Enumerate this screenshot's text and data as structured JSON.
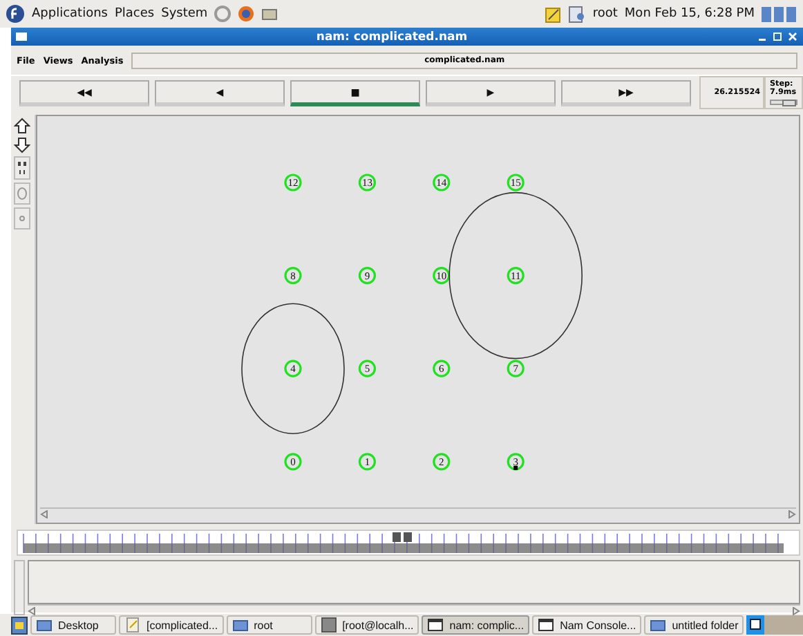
{
  "top_panel": {
    "menus": [
      "Applications",
      "Places",
      "System"
    ],
    "user": "root",
    "clock": "Mon Feb 15,  6:28 PM"
  },
  "window": {
    "title": "nam: complicated.nam"
  },
  "menu_bar": {
    "items": [
      "File",
      "Views",
      "Analysis"
    ],
    "file_name": "complicated.nam"
  },
  "playback": {
    "buttons": [
      {
        "glyph": "◀◀",
        "selected": false
      },
      {
        "glyph": "◀",
        "selected": false
      },
      {
        "glyph": "■",
        "selected": true
      },
      {
        "glyph": "▶",
        "selected": false
      },
      {
        "glyph": "▶▶",
        "selected": false
      }
    ],
    "time": "26.215524",
    "step": "Step: 7.9ms",
    "step_slider": {
      "level": 0.72
    }
  },
  "nodes": [
    {
      "label": "12",
      "kind": "plain",
      "packet": false
    },
    {
      "label": "13",
      "kind": "plain",
      "packet": false
    },
    {
      "label": "14",
      "kind": "plain",
      "packet": false
    },
    {
      "label": "15",
      "kind": "plain",
      "packet": false
    },
    {
      "label": "8",
      "kind": "plain",
      "packet": false
    },
    {
      "label": "9",
      "kind": "plain",
      "packet": false
    },
    {
      "label": "10",
      "kind": "plain",
      "packet": false
    },
    {
      "label": "11",
      "kind": "large",
      "packet": false
    },
    {
      "label": "4",
      "kind": "small",
      "packet": false
    },
    {
      "label": "5",
      "kind": "plain",
      "packet": false
    },
    {
      "label": "6",
      "kind": "plain",
      "packet": false
    },
    {
      "label": "7",
      "kind": "plain",
      "packet": false
    },
    {
      "label": "0",
      "kind": "plain",
      "packet": false
    },
    {
      "label": "1",
      "kind": "plain",
      "packet": false
    },
    {
      "label": "2",
      "kind": "plain",
      "packet": false
    },
    {
      "label": "3",
      "kind": "plain",
      "packet": true
    }
  ],
  "timeline": {
    "level": 0.5
  },
  "taskbar": {
    "items": [
      {
        "label": "Desktop",
        "kind": "folder",
        "selected": false
      },
      {
        "label": "[complicated...",
        "kind": "note",
        "selected": false
      },
      {
        "label": "root",
        "kind": "folder",
        "selected": false
      },
      {
        "label": "[root@localh...",
        "kind": "terminal",
        "selected": false
      },
      {
        "label": "nam: complic...",
        "kind": "window",
        "selected": true
      },
      {
        "label": "Nam Console...",
        "kind": "window",
        "selected": false
      },
      {
        "label": "untitled folder",
        "kind": "folder",
        "selected": false
      }
    ]
  }
}
